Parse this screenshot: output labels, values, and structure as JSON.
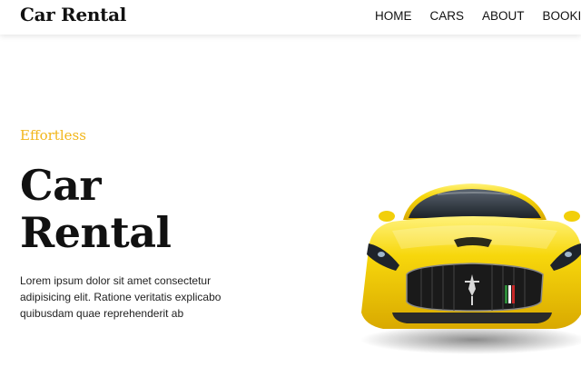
{
  "navbar": {
    "brand": "Car Rental",
    "links": [
      "HOME",
      "CARS",
      "ABOUT",
      "BOOKING"
    ]
  },
  "hero": {
    "tagline": "Effortless",
    "title_line1": "Car",
    "title_line2": "Rental",
    "description": "Lorem ipsum dolor sit amet consectetur adipisicing elit. Ratione veritatis explicabo quibusdam quae reprehenderit ab",
    "image": "yellow-sports-car"
  },
  "colors": {
    "accent": "#f2b619",
    "car_body": "#f5d20a",
    "text": "#111111",
    "background": "#ffffff"
  }
}
